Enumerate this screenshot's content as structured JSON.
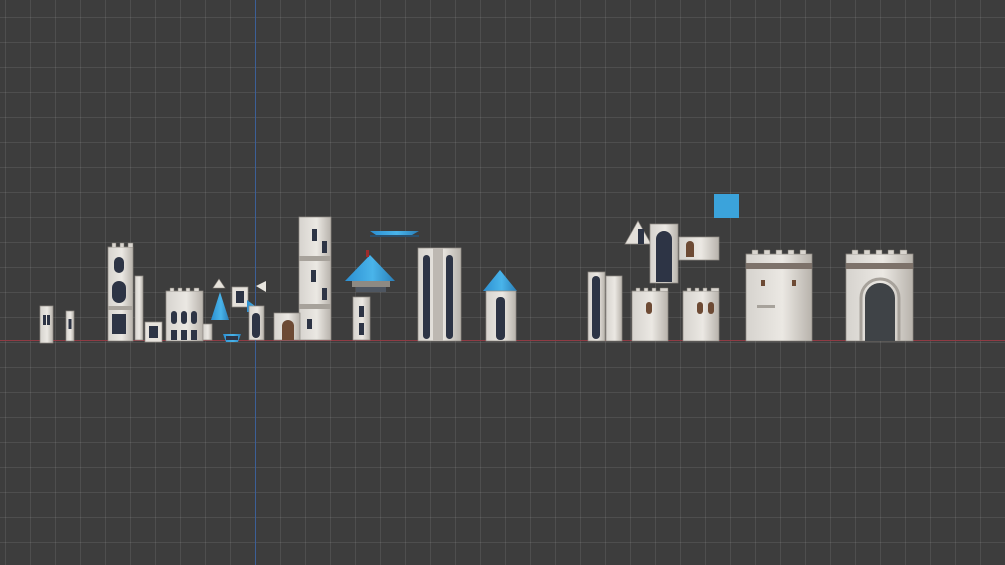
{
  "app": {
    "title": "",
    "view": "3D viewport - orthographic front view"
  },
  "colors": {
    "background": "#3d3d3d",
    "grid": "#4a4a4a",
    "x_axis": "#8f3b44",
    "y_axis": "#3c5f96",
    "stone": "#d7d4cf",
    "stone_shadow": "#a9a49d",
    "roof_blue": "#3ba3db",
    "window_dark": "#2d3445",
    "door_brown": "#6d4a34"
  },
  "scene": {
    "objects": [
      {
        "name": "small-wall-window-piece",
        "icon": "castle-module"
      },
      {
        "name": "narrow-window-piece",
        "icon": "castle-module"
      },
      {
        "name": "tall-gothic-tower",
        "icon": "castle-module"
      },
      {
        "name": "thin-pillar",
        "icon": "castle-module"
      },
      {
        "name": "small-frame-window",
        "icon": "castle-module"
      },
      {
        "name": "three-window-facade",
        "icon": "castle-module"
      },
      {
        "name": "blue-spire-roof",
        "icon": "castle-module"
      },
      {
        "name": "blue-bowl-cap",
        "icon": "castle-module"
      },
      {
        "name": "window-tile",
        "icon": "castle-module"
      },
      {
        "name": "small-gable-pieces",
        "icon": "castle-module"
      },
      {
        "name": "arched-window-pillar",
        "icon": "castle-module"
      },
      {
        "name": "round-tower",
        "icon": "castle-module"
      },
      {
        "name": "blue-conical-roof-tower",
        "icon": "castle-module"
      },
      {
        "name": "flat-blue-roof-plate",
        "icon": "castle-module"
      },
      {
        "name": "twin-window-tower",
        "icon": "castle-module"
      },
      {
        "name": "conical-roof-small-tower",
        "icon": "castle-module"
      },
      {
        "name": "window-column-pair",
        "icon": "castle-module"
      },
      {
        "name": "gable-with-tall-window",
        "icon": "castle-module"
      },
      {
        "name": "wall-window-block",
        "icon": "castle-module"
      },
      {
        "name": "blue-square-plate",
        "icon": "castle-module"
      },
      {
        "name": "square-tower-single-window",
        "icon": "castle-module"
      },
      {
        "name": "square-tower-two-windows",
        "icon": "castle-module"
      },
      {
        "name": "crenellated-wall-block",
        "icon": "castle-module"
      },
      {
        "name": "arched-gatehouse",
        "icon": "castle-module"
      }
    ]
  }
}
